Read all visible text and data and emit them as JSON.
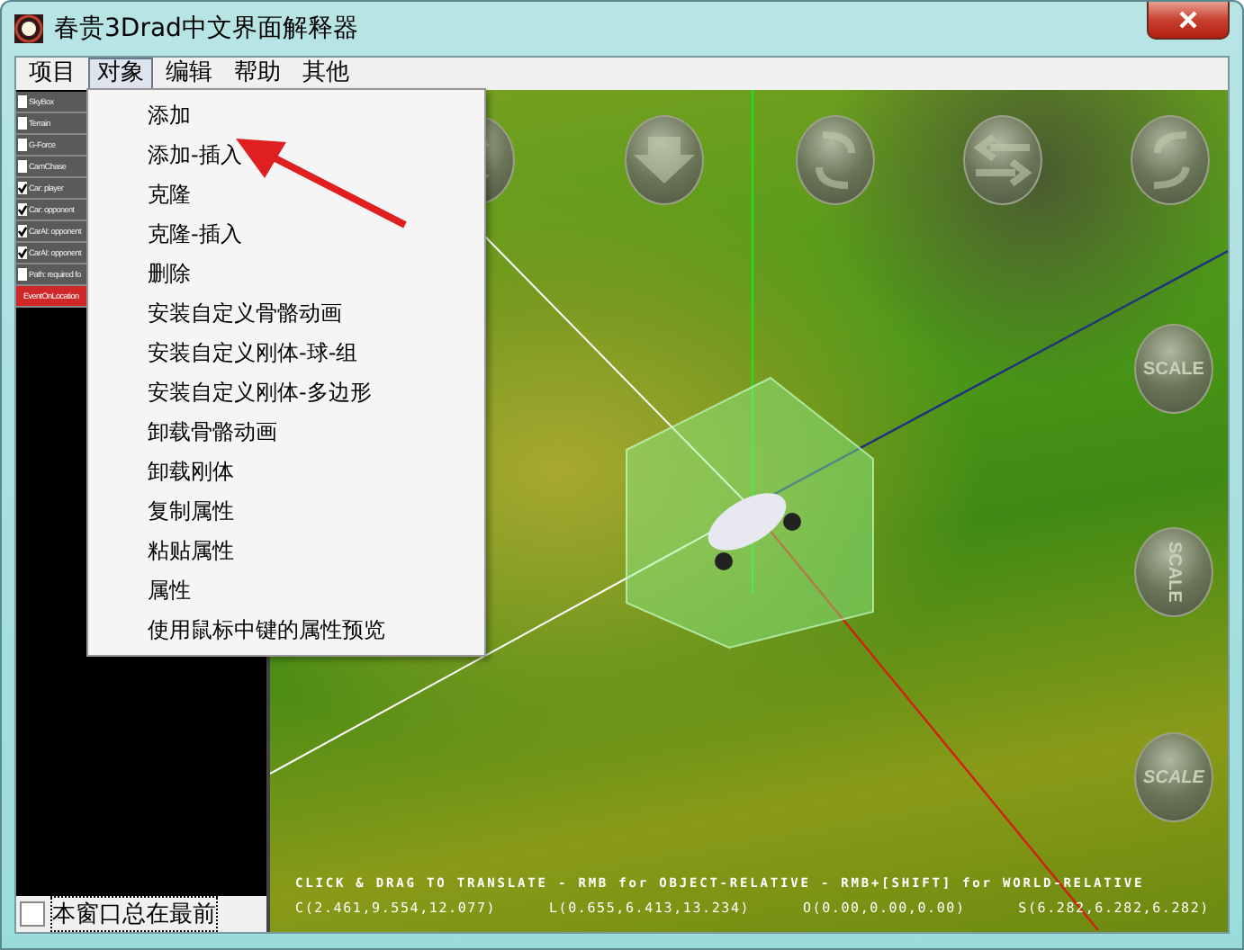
{
  "window": {
    "title": "春贵3Drad中文界面解释器"
  },
  "menu_bar": [
    {
      "label": "项目",
      "selected": false
    },
    {
      "label": "对象",
      "selected": true
    },
    {
      "label": "编辑",
      "selected": false
    },
    {
      "label": "帮助",
      "selected": false
    },
    {
      "label": "其他",
      "selected": false
    }
  ],
  "object_list": [
    {
      "label": "SkyBox",
      "checked": false,
      "selected": false
    },
    {
      "label": "Terrain",
      "checked": false,
      "selected": false
    },
    {
      "label": "G-Force",
      "checked": false,
      "selected": false
    },
    {
      "label": "CamChase",
      "checked": false,
      "selected": false
    },
    {
      "label": "Car: player",
      "checked": true,
      "selected": false
    },
    {
      "label": "Car: opponent",
      "checked": true,
      "selected": false
    },
    {
      "label": "CarAI: opponent",
      "checked": true,
      "selected": false
    },
    {
      "label": "CarAI: opponent",
      "checked": true,
      "selected": false
    },
    {
      "label": "Path: required fo",
      "checked": false,
      "selected": false
    },
    {
      "label": "EventOnLocation",
      "selected": true
    }
  ],
  "dropdown_menu": [
    "添加",
    "添加-插入",
    "克隆",
    "克隆-插入",
    "删除",
    "安装自定义骨骼动画",
    "安装自定义刚体-球-组",
    "安装自定义刚体-多边形",
    "卸载骨骼动画",
    "卸载刚体",
    "复制属性",
    "粘贴属性",
    "属性",
    "使用鼠标中键的属性预览"
  ],
  "always_on_top": {
    "label": "本窗口总在最前",
    "checked": false
  },
  "viewport": {
    "scale_buttons": [
      "SCALE",
      "SCALE",
      "SCALE"
    ],
    "hint": "CLICK & DRAG TO TRANSLATE - RMB for OBJECT-RELATIVE - RMB+[SHIFT] for WORLD-RELATIVE",
    "readouts": [
      "C(2.461,9.554,12.077)",
      "L(0.655,6.413,13.234)",
      "O(0.00,0.00,0.00)",
      "S(6.282,6.282,6.282)"
    ]
  }
}
